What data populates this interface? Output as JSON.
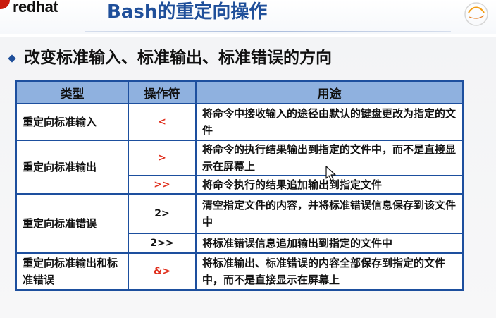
{
  "header": {
    "logo_text": "redhat",
    "title": "Bash的重定向操作"
  },
  "subtitle": "改变标准输入、标准输出、标准错误的方向",
  "table": {
    "columns": [
      "类型",
      "操作符",
      "用途"
    ],
    "rows": [
      {
        "type": "重定向标准输入",
        "operator": "<",
        "use": "将命令中接收输入的途径由默认的键盘更改为指定的文件"
      },
      {
        "type": "重定向标准输出",
        "operator": ">",
        "use": "将命令的执行结果输出到指定的文件中，而不是直接显示在屏幕上"
      },
      {
        "type": "",
        "operator": ">>",
        "use": "将命令执行的结果追加输出到指定文件"
      },
      {
        "type": "重定向标准错误",
        "operator": "2>",
        "use": "清空指定文件的内容，并将标准错误信息保存到该文件中"
      },
      {
        "type": "",
        "operator": "2>>",
        "use": "将标准错误信息追加输出到指定的文件中"
      },
      {
        "type": "重定向标准输出和标准错误",
        "operator": "&>",
        "use": "将标准输出、标准错误的内容全部保存到指定的文件中，而不是直接显示在屏幕上"
      }
    ]
  },
  "colors": {
    "title": "#1f4f9a",
    "header_bg": "#8fb1df",
    "border": "#1d4f9e",
    "operator_red": "#e0301e"
  }
}
